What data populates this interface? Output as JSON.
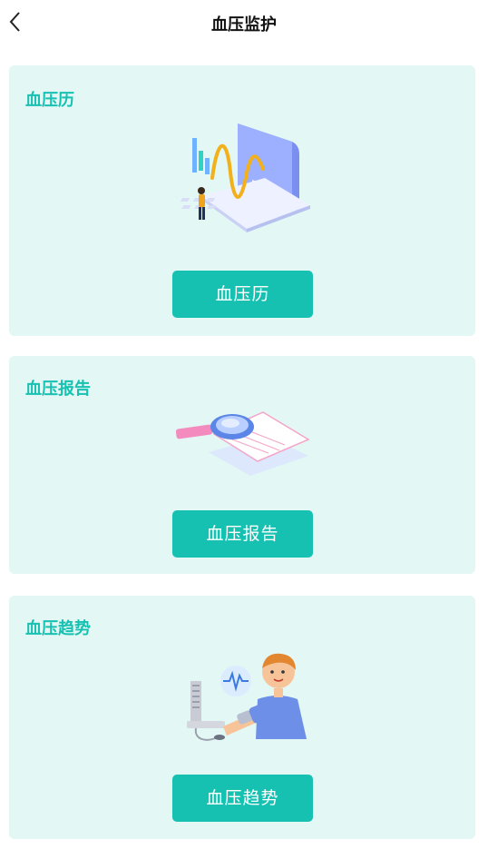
{
  "header": {
    "title": "血压监护"
  },
  "cards": [
    {
      "title": "血压历",
      "button": "血压历"
    },
    {
      "title": "血压报告",
      "button": "血压报告"
    },
    {
      "title": "血压趋势",
      "button": "血压趋势"
    }
  ],
  "colors": {
    "accent": "#17c1b2",
    "card_bg": "#e3f7f4"
  }
}
